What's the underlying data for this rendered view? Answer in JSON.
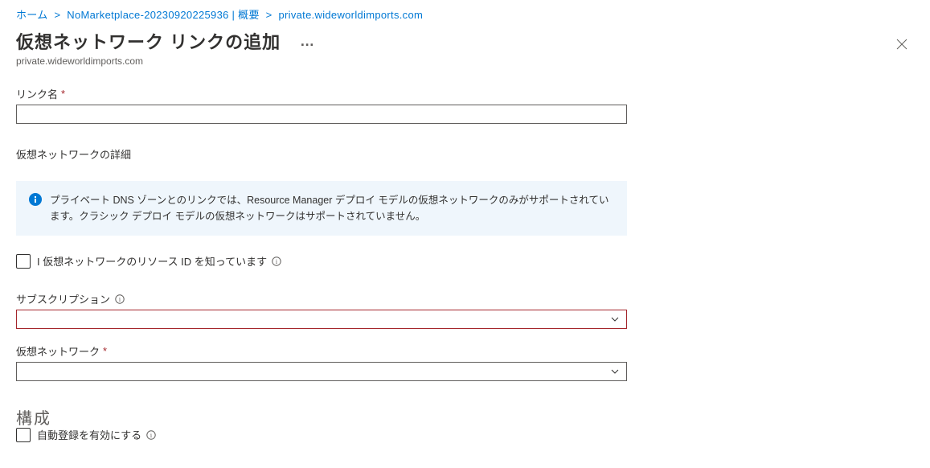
{
  "breadcrumb": {
    "home": "ホーム",
    "item1": "NoMarketplace-20230920225936 | 概要",
    "item2": "private.wideworldimports.com"
  },
  "header": {
    "title": "仮想ネットワーク リンクの追加",
    "more": "…",
    "subtitle": "private.wideworldimports.com"
  },
  "form": {
    "linkNameLabel": "リンク名",
    "linkNameValue": "",
    "vnetDetailsLabel": "仮想ネットワークの詳細",
    "infoText": "プライベート DNS ゾーンとのリンクでは、Resource Manager デプロイ モデルの仮想ネットワークのみがサポートされています。クラシック デプロイ モデルの仮想ネットワークはサポートされていません。",
    "knowResourceIdLabel": "I 仮想ネットワークのリソース ID を知っています",
    "subscriptionLabel": "サブスクリプション",
    "vnetLabel": "仮想ネットワーク",
    "configHeading": "構成",
    "autoRegLabel": "自動登録を有効にする"
  }
}
